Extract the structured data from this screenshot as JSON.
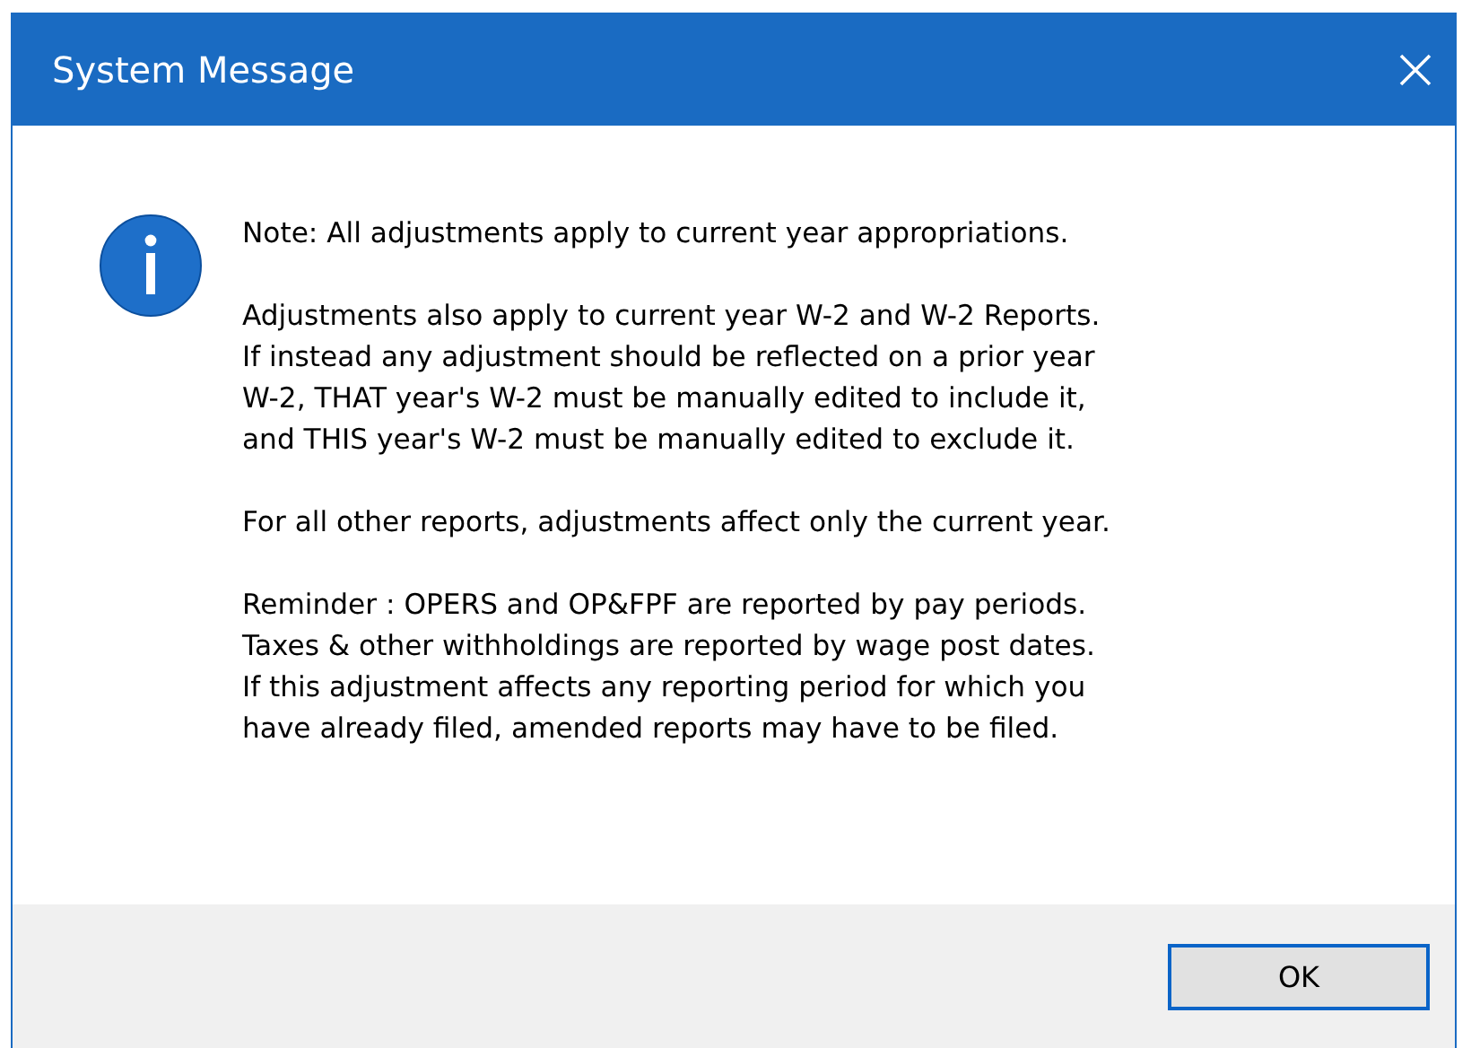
{
  "window": {
    "title": "System Message"
  },
  "message": {
    "paragraphs": [
      "Note: All adjustments apply to current year appropriations.",
      "Adjustments also apply to current year W-2 and W-2 Reports.\nIf instead any adjustment should be reflected on a prior year\nW-2, THAT year's W-2 must be manually edited to include it,\nand THIS year's W-2 must be manually edited to exclude it.",
      "For all other reports, adjustments affect only the current year.",
      "Reminder : OPERS and OP&FPF are reported by pay periods.\nTaxes & other withholdings are reported by wage post dates.\nIf this adjustment affects any reporting period for which you\nhave already filed, amended reports may have to be filed."
    ]
  },
  "buttons": [
    {
      "label": "OK",
      "default": true
    }
  ]
}
